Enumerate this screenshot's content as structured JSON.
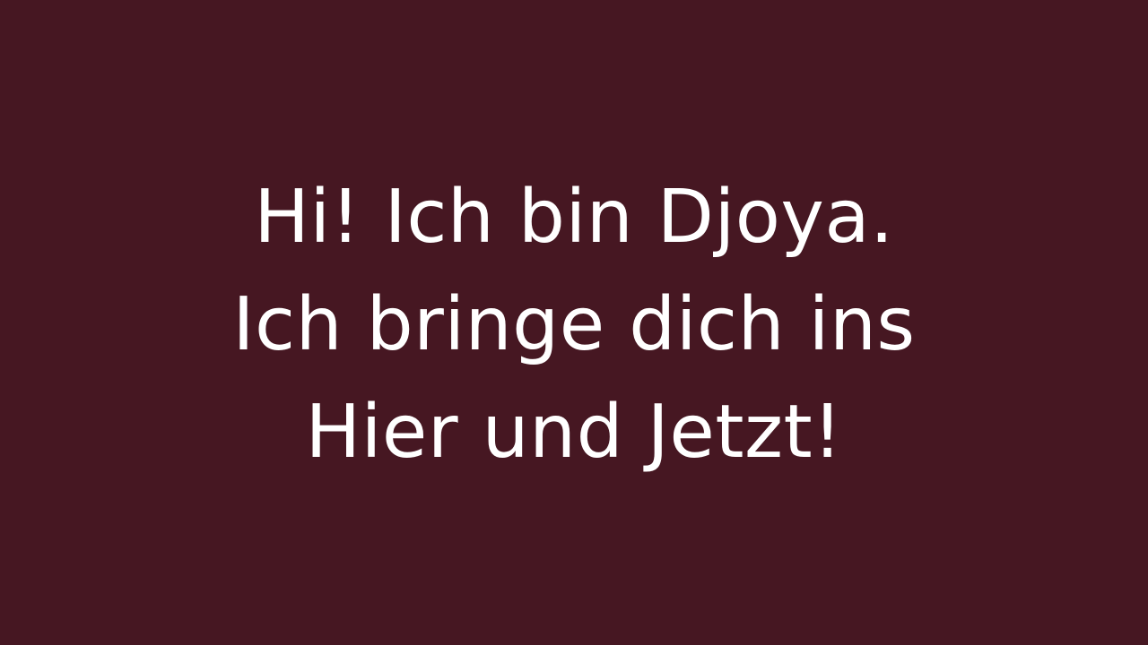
{
  "background_color": "#461722",
  "text_color": "#ffffff",
  "lines": [
    "Hi! Ich bin Djoya.",
    "Ich bringe dich ins",
    "Hier und Jetzt!"
  ]
}
